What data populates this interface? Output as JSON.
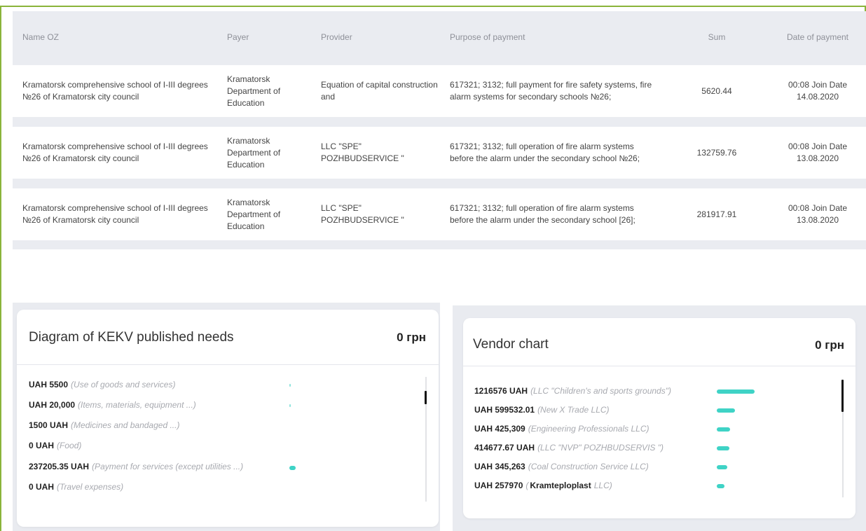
{
  "table": {
    "headers": {
      "name": "Name OZ",
      "payer": "Payer",
      "provider": "Provider",
      "purpose": "Purpose of payment",
      "sum": "Sum",
      "date": "Date of payment"
    },
    "rows": [
      {
        "name": "Kramatorsk comprehensive school of I-III degrees №26 of Kramatorsk city council",
        "payer": "Kramatorsk Department of Education",
        "provider": "Equation of capital construction and",
        "purpose": "617321; 3132; full payment for fire safety systems, fire alarm systems for secondary schools №26;",
        "sum": "5620.44",
        "date": "00:08 Join Date 14.08.2020"
      },
      {
        "name": "Kramatorsk comprehensive school of I-III degrees №26 of Kramatorsk city council",
        "payer": "Kramatorsk Department of Education",
        "provider": "LLC \"SPE\" POZHBUDSERVICE \"",
        "purpose": "617321; 3132; full operation of fire alarm systems before the alarm under the secondary school №26;",
        "sum": "132759.76",
        "date": "00:08 Join Date 13.08.2020"
      },
      {
        "name": "Kramatorsk comprehensive school of I-III degrees №26 of Kramatorsk city council",
        "payer": "Kramatorsk Department of Education",
        "provider": "LLC \"SPE\" POZHBUDSERVICE \"",
        "purpose": "617321; 3132; full operation of fire alarm systems before the alarm under the secondary school [26];",
        "sum": "281917.91",
        "date": "00:08 Join Date 13.08.2020"
      }
    ]
  },
  "kekv_card": {
    "title": "Diagram of KEKV published needs",
    "amount": "0 грн",
    "items": [
      {
        "amount": "UAH 5500",
        "desc": "(Use of goods and services)"
      },
      {
        "amount": "UAH 20,000",
        "desc": "(Items, materials, equipment ...)"
      },
      {
        "amount": "1500 UAH",
        "desc": "(Medicines and bandaged ...)"
      },
      {
        "amount": "0 UAH",
        "desc": "(Food)"
      },
      {
        "amount": "237205.35 UAH",
        "desc": "(Payment for services (except utilities ...)"
      },
      {
        "amount": "0 UAH",
        "desc": "(Travel expenses)"
      }
    ]
  },
  "vendor_card": {
    "title": "Vendor chart",
    "amount": "0 грн",
    "items": [
      {
        "amount": "1216576 UAH",
        "desc": "(LLC \"Children's and sports grounds\")",
        "bar": 1.0
      },
      {
        "amount": "UAH 599532.01",
        "desc": "(New X Trade LLC)",
        "bar": 0.49
      },
      {
        "amount": "UAH 425,309",
        "desc": "(Engineering Professionals LLC)",
        "bar": 0.35
      },
      {
        "amount": "414677.67 UAH",
        "desc": "(LLC \"NVP\" POZHBUDSERVIS \")",
        "bar": 0.34
      },
      {
        "amount": "UAH 345,263",
        "desc": "(Coal Construction Service LLC)",
        "bar": 0.28
      },
      {
        "amount": "UAH 257970",
        "desc_pre": "(",
        "desc_main": "Kramteploplast",
        "desc_post": "LLC)",
        "bar": 0.21
      }
    ]
  },
  "colors": {
    "accent": "#8ab43a",
    "bar": "#3fd3c6",
    "table_bg": "#eaecf1"
  }
}
